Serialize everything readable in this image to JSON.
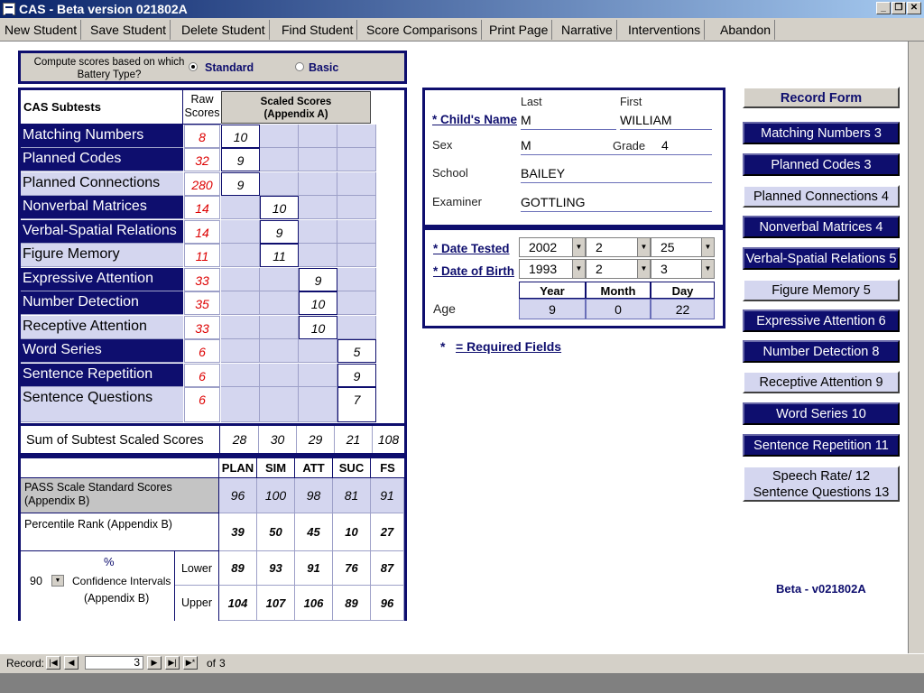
{
  "window": {
    "title": "CAS - Beta version 021802A"
  },
  "menu": [
    "New Student",
    "Save Student",
    "Delete Student",
    "Find Student",
    "Score Comparisons",
    "Print Page",
    "Narrative",
    "Interventions",
    "Abandon"
  ],
  "battery": {
    "question": "Compute scores based on which Battery Type?",
    "options": [
      "Standard",
      "Basic"
    ],
    "selected": "Standard"
  },
  "subtests": {
    "col_subtests": "CAS Subtests",
    "col_raw": "Raw Scores",
    "col_scaled": "Scaled Scores (Appendix A)",
    "rows": [
      {
        "name": "Matching Numbers",
        "raw": "8",
        "col": 0,
        "scaled": "10",
        "dark": true
      },
      {
        "name": "Planned Codes",
        "raw": "32",
        "col": 0,
        "scaled": "9",
        "dark": true
      },
      {
        "name": "Planned Connections",
        "raw": "280",
        "col": 0,
        "scaled": "9",
        "dark": false
      },
      {
        "name": "Nonverbal Matrices",
        "raw": "14",
        "col": 1,
        "scaled": "10",
        "dark": true
      },
      {
        "name": "Verbal-Spatial Relations",
        "raw": "14",
        "col": 1,
        "scaled": "9",
        "dark": true
      },
      {
        "name": "Figure Memory",
        "raw": "11",
        "col": 1,
        "scaled": "11",
        "dark": false
      },
      {
        "name": "Expressive Attention",
        "raw": "33",
        "col": 2,
        "scaled": "9",
        "dark": true
      },
      {
        "name": "Number Detection",
        "raw": "35",
        "col": 2,
        "scaled": "10",
        "dark": true
      },
      {
        "name": "Receptive Attention",
        "raw": "33",
        "col": 2,
        "scaled": "10",
        "dark": false
      },
      {
        "name": "Word Series",
        "raw": "6",
        "col": 3,
        "scaled": "5",
        "dark": true
      },
      {
        "name": "Sentence Repetition",
        "raw": "6",
        "col": 3,
        "scaled": "9",
        "dark": true
      },
      {
        "name": "Sentence Questions",
        "raw": "6",
        "col": 3,
        "scaled": "7",
        "dark": false
      }
    ]
  },
  "sums": {
    "label": "Sum of Subtest Scaled Scores",
    "values": [
      "28",
      "30",
      "29",
      "21",
      "108"
    ]
  },
  "pass": {
    "headers": [
      "PLAN",
      "SIM",
      "ATT",
      "SUC",
      "FS"
    ],
    "standard_label": "PASS Scale Standard Scores (Appendix B)",
    "standard": [
      "96",
      "100",
      "98",
      "81",
      "91"
    ],
    "percentile_label": "Percentile Rank (Appendix B)",
    "percentile": [
      "39",
      "50",
      "45",
      "10",
      "27"
    ],
    "ci_percent_symbol": "%",
    "ci_level": "90",
    "ci_label": "Confidence Intervals",
    "ci_appendix": "(Appendix B)",
    "lower_label": "Lower",
    "upper_label": "Upper",
    "lower": [
      "89",
      "93",
      "91",
      "76",
      "87"
    ],
    "upper": [
      "104",
      "107",
      "106",
      "89",
      "96"
    ]
  },
  "child": {
    "last_header": "Last",
    "first_header": "First",
    "name_label": "* Child's Name",
    "last": "M",
    "first": "WILLIAM",
    "sex_label": "Sex",
    "sex": "M",
    "grade_label": "Grade",
    "grade": "4",
    "school_label": "School",
    "school": "BAILEY",
    "examiner_label": "Examiner",
    "examiner": "GOTTLING"
  },
  "dates": {
    "tested_label": "* Date Tested",
    "tested": [
      "2002",
      "2",
      "25"
    ],
    "birth_label": "* Date of Birth",
    "birth": [
      "1993",
      "2",
      "3"
    ],
    "age_headers": [
      "Year",
      "Month",
      "Day"
    ],
    "age_label": "Age",
    "age": [
      "9",
      "0",
      "22"
    ]
  },
  "required_note": {
    "star": "*",
    "text": "= Required Fields"
  },
  "record_form": [
    {
      "label": "Record Form",
      "style": "header"
    },
    {
      "label": "Matching Numbers 3",
      "style": "dark"
    },
    {
      "label": "Planned Codes 3",
      "style": "dark"
    },
    {
      "label": "Planned Connections 4",
      "style": "light"
    },
    {
      "label": "Nonverbal Matrices 4",
      "style": "dark"
    },
    {
      "label": "Verbal-Spatial Relations 5",
      "style": "dark"
    },
    {
      "label": "Figure Memory 5",
      "style": "light"
    },
    {
      "label": "Expressive Attention 6",
      "style": "dark"
    },
    {
      "label": "Number Detection 8",
      "style": "dark"
    },
    {
      "label": "Receptive Attention 9",
      "style": "light"
    },
    {
      "label": "Word Series 10",
      "style": "dark"
    },
    {
      "label": "Sentence Repetition 11",
      "style": "dark"
    },
    {
      "label": "Speech Rate/ 12 Sentence Questions 13",
      "style": "light"
    }
  ],
  "version": "Beta - v021802A",
  "record_nav": {
    "label": "Record:",
    "current": "3",
    "of_label": "of",
    "total": "3"
  }
}
